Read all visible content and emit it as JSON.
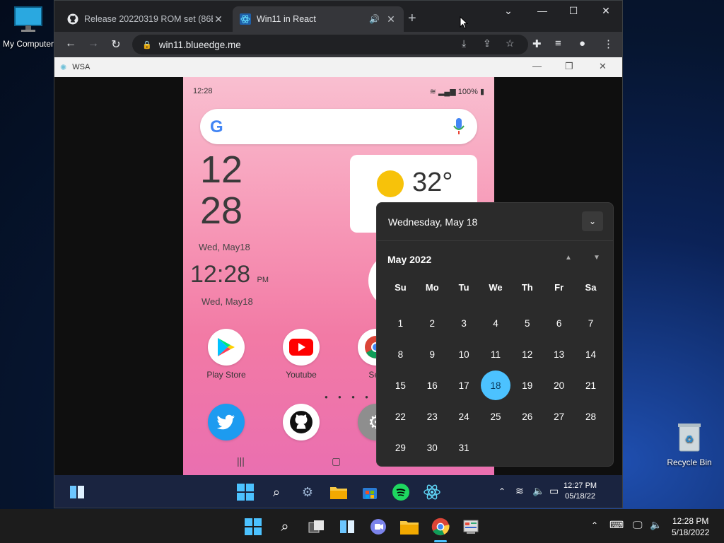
{
  "desktop": {
    "my_computer_label": "My Computer",
    "recycle_bin_label": "Recycle Bin"
  },
  "browser": {
    "tabs": [
      {
        "title": "Release 20220319 ROM set (86B"
      },
      {
        "title": "Win11 in React"
      }
    ],
    "url": "win11.blueedge.me"
  },
  "wsa": {
    "title": "WSA"
  },
  "android": {
    "status_time": "12:28",
    "battery": "100%",
    "clock_hour": "12",
    "clock_min": "28",
    "date_short": "Wed, May18",
    "clock_digital": "12:28",
    "ampm": "PM",
    "date_short2": "Wed, May18",
    "weather_temp": "32°",
    "apps": [
      {
        "label": "Play Store"
      },
      {
        "label": "Youtube"
      },
      {
        "label": "Sea"
      }
    ]
  },
  "calendar": {
    "header_date": "Wednesday, May 18",
    "month_label": "May 2022",
    "weekdays": [
      "Su",
      "Mo",
      "Tu",
      "We",
      "Th",
      "Fr",
      "Sa"
    ],
    "weeks": [
      [
        "1",
        "2",
        "3",
        "4",
        "5",
        "6",
        "7"
      ],
      [
        "8",
        "9",
        "10",
        "11",
        "12",
        "13",
        "14"
      ],
      [
        "15",
        "16",
        "17",
        "18",
        "19",
        "20",
        "21"
      ],
      [
        "22",
        "23",
        "24",
        "25",
        "26",
        "27",
        "28"
      ],
      [
        "29",
        "30",
        "31",
        "",
        "",
        "",
        ""
      ]
    ],
    "today": "18"
  },
  "inner_taskbar": {
    "time": "12:27 PM",
    "date": "05/18/22"
  },
  "host_taskbar": {
    "time": "12:28 PM",
    "date": "5/18/2022"
  }
}
